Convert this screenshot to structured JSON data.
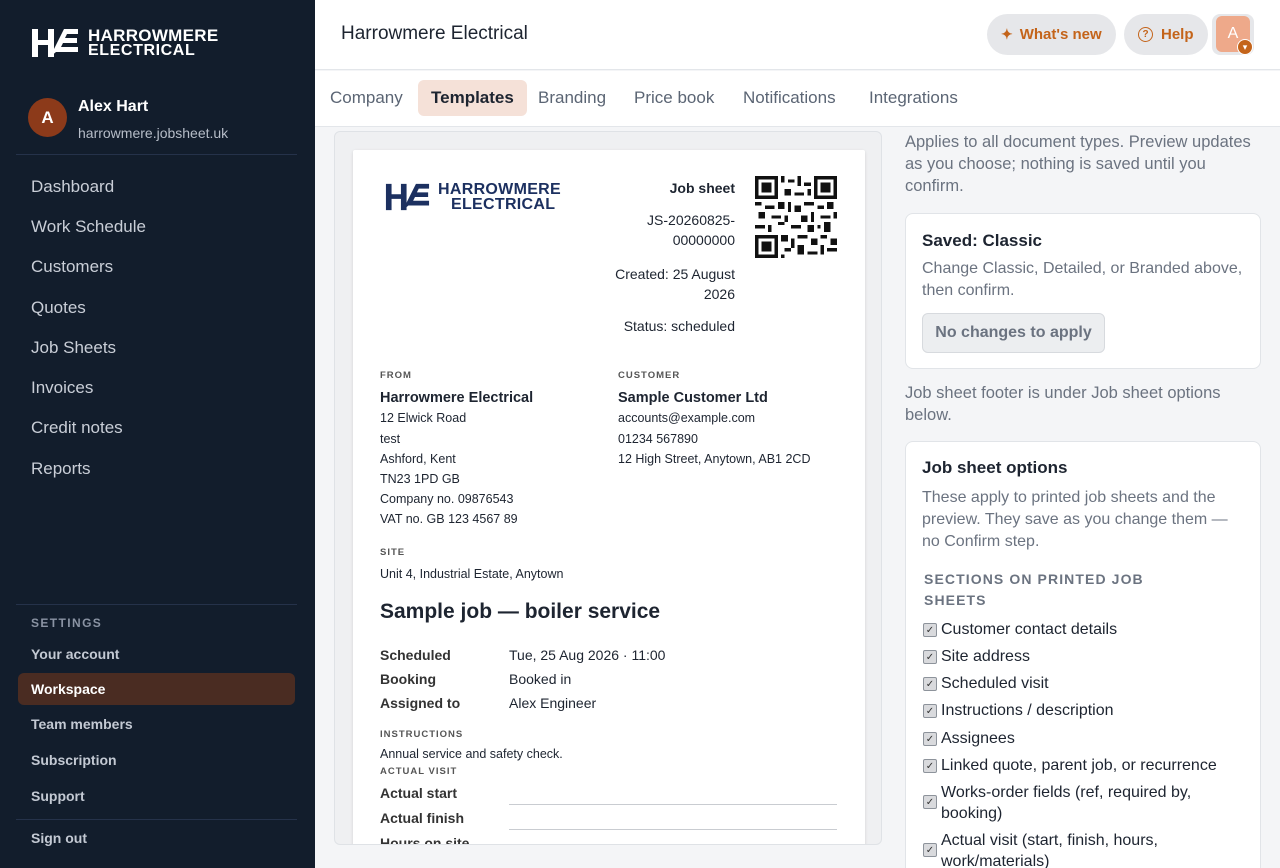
{
  "brand": {
    "name_line1": "HARROWMERE",
    "name_line2": "ELECTRICAL",
    "accent": "#c4641a",
    "sidebar_bg": "#121d2c"
  },
  "user": {
    "initial": "A",
    "name": "Alex Hart",
    "domain": "harrowmere.jobsheet.uk"
  },
  "nav": {
    "items": [
      "Dashboard",
      "Work Schedule",
      "Customers",
      "Quotes",
      "Job Sheets",
      "Invoices",
      "Credit notes",
      "Reports"
    ]
  },
  "settings": {
    "label": "SETTINGS",
    "items": [
      "Your account",
      "Workspace",
      "Team members",
      "Subscription",
      "Support"
    ],
    "active": "Workspace",
    "sign_out": "Sign out"
  },
  "header": {
    "title": "Harrowmere Electrical",
    "whats_new": "What's new",
    "help": "Help",
    "avatar_initial": "A"
  },
  "tabs": [
    "Company",
    "Templates",
    "Branding",
    "Price book",
    "Notifications",
    "Integrations"
  ],
  "active_tab": "Templates",
  "preview": {
    "doc_type": "Job sheet",
    "doc_number_1": "JS-20260825-",
    "doc_number_2": "00000000",
    "created_1": "Created: 25 August",
    "created_2": "2026",
    "status": "Status: scheduled",
    "from_label": "FROM",
    "from": {
      "name": "Harrowmere Electrical",
      "lines": [
        "12 Elwick Road",
        "test",
        "Ashford, Kent",
        "TN23 1PD GB",
        "Company no. 09876543",
        "VAT no. GB 123 4567 89"
      ]
    },
    "customer_label": "CUSTOMER",
    "customer": {
      "name": "Sample Customer Ltd",
      "lines": [
        "accounts@example.com",
        "01234 567890",
        "12 High Street, Anytown, AB1 2CD"
      ]
    },
    "site_label": "SITE",
    "site": "Unit 4, Industrial Estate, Anytown",
    "job_title": "Sample job — boiler service",
    "fields": [
      {
        "k": "Scheduled",
        "v": "Tue, 25 Aug 2026 · 11:00"
      },
      {
        "k": "Booking",
        "v": "Booked in"
      },
      {
        "k": "Assigned to",
        "v": "Alex Engineer"
      }
    ],
    "instructions_label": "INSTRUCTIONS",
    "instructions": "Annual service and safety check.",
    "actual_visit_label": "ACTUAL VISIT",
    "actual_fields": [
      "Actual start",
      "Actual finish",
      "Hours on site"
    ]
  },
  "panel": {
    "intro": "Applies to all document types. Preview updates as you choose; nothing is saved until you confirm.",
    "saved_title": "Saved: Classic",
    "saved_desc": "Change Classic, Detailed, or Branded above, then confirm.",
    "no_changes_button": "No changes to apply",
    "footer_note": "Job sheet footer is under Job sheet options below.",
    "options_title": "Job sheet options",
    "options_desc": "These apply to printed job sheets and the preview. They save as you change them — no Confirm step.",
    "sections_label": "SECTIONS ON PRINTED JOB SHEETS",
    "checkboxes": [
      {
        "label": "Customer contact details",
        "checked": true
      },
      {
        "label": "Site address",
        "checked": true
      },
      {
        "label": "Scheduled visit",
        "checked": true
      },
      {
        "label": "Instructions / description",
        "checked": true
      },
      {
        "label": "Assignees",
        "checked": true
      },
      {
        "label": "Linked quote, parent job, or recurrence",
        "checked": true
      },
      {
        "label": "Works-order fields (ref, required by, booking)",
        "checked": true
      },
      {
        "label": "Actual visit (start, finish, hours, work/materials)",
        "checked": true
      }
    ]
  }
}
